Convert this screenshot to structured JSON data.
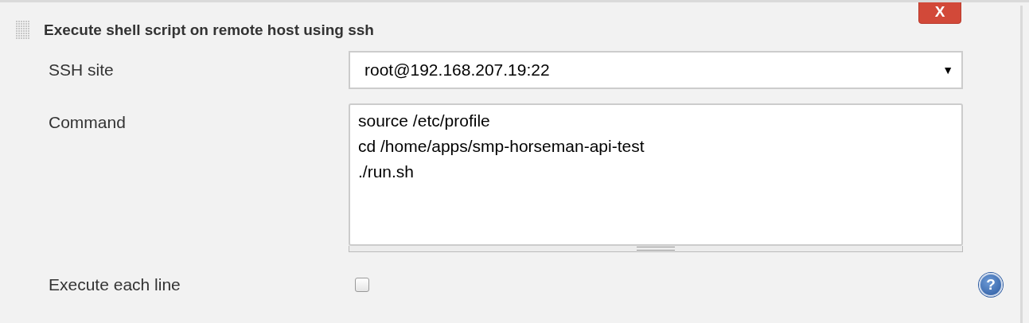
{
  "section": {
    "title": "Execute shell script on remote host using ssh",
    "delete_button": "X"
  },
  "fields": [
    {
      "kind": "select",
      "label": "SSH site",
      "value": "root@192.168.207.19:22",
      "caret": "▼"
    },
    {
      "kind": "textarea",
      "label": "Command",
      "value": "source /etc/profile\ncd /home/apps/smp-horseman-api-test\n./run.sh"
    },
    {
      "kind": "checkbox",
      "label": "Execute each line",
      "checked": false,
      "help": "?"
    }
  ]
}
